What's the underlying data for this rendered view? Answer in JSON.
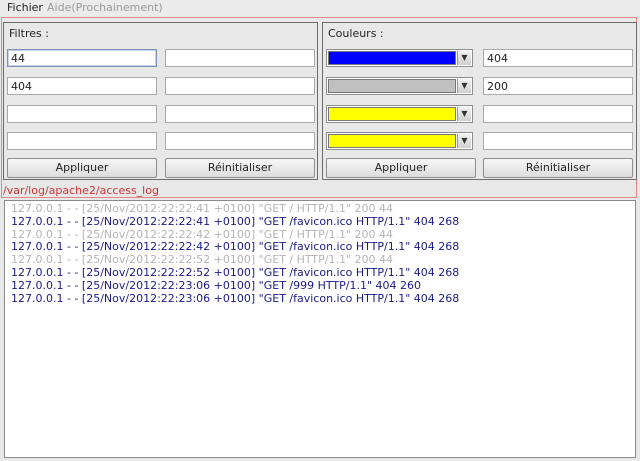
{
  "menu": {
    "file": "Fichier",
    "help": "Aide(Prochainement)"
  },
  "filters": {
    "title": "Filtres :",
    "fields": [
      {
        "value": "44"
      },
      {
        "value": ""
      },
      {
        "value": "404"
      },
      {
        "value": ""
      },
      {
        "value": ""
      },
      {
        "value": ""
      },
      {
        "value": ""
      },
      {
        "value": ""
      }
    ],
    "apply_label": "Appliquer",
    "reset_label": "Réinitialiser"
  },
  "colors": {
    "title": "Couleurs :",
    "rows": [
      {
        "swatch": "#0000ff",
        "value": "404"
      },
      {
        "swatch": "#c0c0c0",
        "value": "200"
      },
      {
        "swatch": "#ffff00",
        "value": ""
      },
      {
        "swatch": "#ffff00",
        "value": ""
      }
    ],
    "apply_label": "Appliquer",
    "reset_label": "Réinitialiser"
  },
  "log_path": "/var/log/apache2/access_log",
  "log_lines": [
    {
      "text": "127.0.0.1 - - [25/Nov/2012:22:22:41 +0100] \"GET / HTTP/1.1\" 200 44",
      "color": "#b4b4b4"
    },
    {
      "text": "127.0.0.1 - - [25/Nov/2012:22:22:41 +0100] \"GET /favicon.ico HTTP/1.1\" 404 268",
      "color": "#1a1a8c"
    },
    {
      "text": "127.0.0.1 - - [25/Nov/2012:22:22:42 +0100] \"GET / HTTP/1.1\" 200 44",
      "color": "#b4b4b4"
    },
    {
      "text": "127.0.0.1 - - [25/Nov/2012:22:22:42 +0100] \"GET /favicon.ico HTTP/1.1\" 404 268",
      "color": "#1a1a8c"
    },
    {
      "text": "127.0.0.1 - - [25/Nov/2012:22:22:52 +0100] \"GET / HTTP/1.1\" 200 44",
      "color": "#b4b4b4"
    },
    {
      "text": "127.0.0.1 - - [25/Nov/2012:22:22:52 +0100] \"GET /favicon.ico HTTP/1.1\" 404 268",
      "color": "#1a1a8c"
    },
    {
      "text": "127.0.0.1 - - [25/Nov/2012:22:23:06 +0100] \"GET /999 HTTP/1.1\" 404 260",
      "color": "#1a1a8c"
    },
    {
      "text": "127.0.0.1 - - [25/Nov/2012:22:23:06 +0100] \"GET /favicon.ico HTTP/1.1\" 404 268",
      "color": "#1a1a8c"
    }
  ]
}
